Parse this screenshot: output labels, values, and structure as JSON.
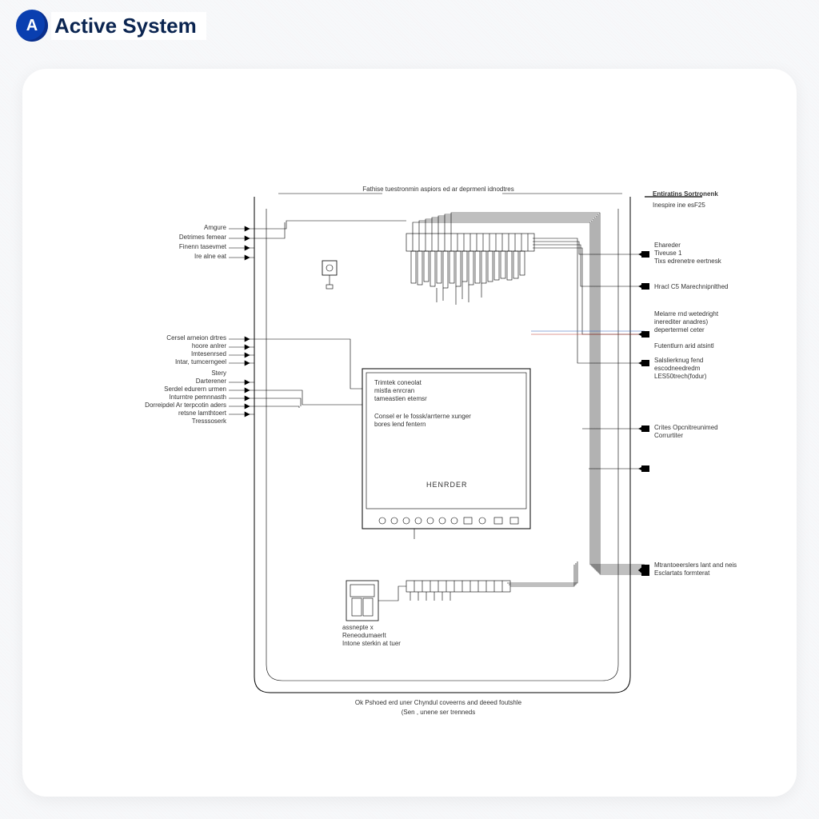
{
  "header": {
    "logo_letter": "A",
    "title": "Active System"
  },
  "diagram": {
    "top_title": "Fathise tuestronmin aspiors ed ar deprmenl idnodtres",
    "left_labels": {
      "l1": "Amgure",
      "l2": "Detrimes femear",
      "l3": "Finenn tasevmet",
      "l4": "Ire alne eat",
      "l5": "Cersel arneion drtres",
      "l6": "hoore anlrer",
      "l7": "Imtesenrsed",
      "l8": "Intar, tumcerngeel",
      "l9": "Stery",
      "l10": "Darterener",
      "l11": "Serdel edurern urmen",
      "l12": "Inturntre pemnnasth",
      "l13": "Dorreipdel Ar terpcotin aders",
      "l14": "retsne lamthtoert",
      "l15": "Tresssoserk"
    },
    "right_labels": {
      "r_title": "Entiratins Sortronenk",
      "r_sub": "Inespire ine esF25",
      "r1a": "Ehareder",
      "r1b": "Tiveuse 1",
      "r1c": "Tixs edrenetre eertnesk",
      "r2": "Hracl C5 Marechnipnlthed",
      "r3a": "Melarre rnd wetedright",
      "r3b": "inerediter anadres)",
      "r3c": "depertermel ceter",
      "r4": "Futentlurn arid atsintl",
      "r5a": "Salslierknug fend",
      "r5b": "escodneedredm",
      "r5c": "LES50trech(fodur)",
      "r6a": "Crites Opcnitreunimed",
      "r6b": "Corrurtiter",
      "r7a": "Mtrantoeerslers lant and neis",
      "r7b": "Esclartats formterat"
    },
    "center_box": {
      "c1": "Trimtek coneolat",
      "c2": "mistla enrcran",
      "c3": "tameastien etemsr",
      "c4": "Consel er Ie fossk/arrterne xunger",
      "c5": "bores lend fentern",
      "device_name": "HENRDER"
    },
    "bottom_module": {
      "b1": "assnepte x",
      "b2": "Reneodumaerlt",
      "b3": "Intone sterkin at tuer"
    },
    "footer": {
      "f1": "Ok Pshoed erd uner Chyndul coveerns and deeed foutshle",
      "f2": "(Sen , unene ser trenneds"
    }
  }
}
